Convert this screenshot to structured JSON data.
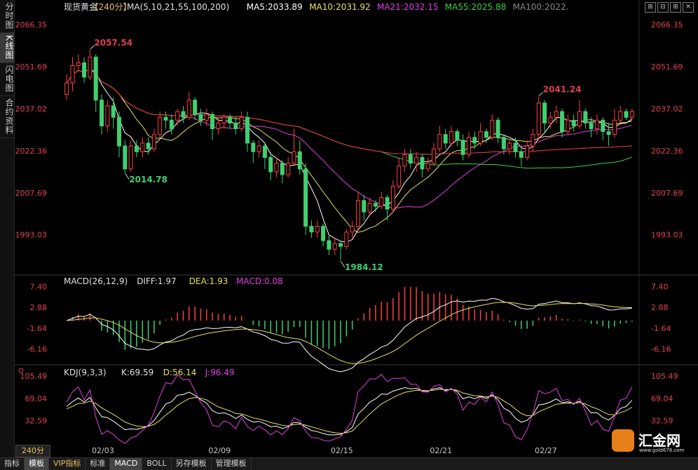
{
  "sidebar": {
    "tabs": [
      {
        "label": "分时图",
        "active": false
      },
      {
        "label": "K线图",
        "active": true
      },
      {
        "label": "闪电图",
        "active": false
      },
      {
        "label": "合约资料",
        "active": false
      }
    ]
  },
  "header": {
    "symbol": "现货黄金",
    "period": "【240分】",
    "ma_label": "MA(5,10,21,55,100,200)",
    "ma5": "MA5:2033.89",
    "ma10": "MA10:2031.92",
    "ma21": "MA21:2032.15",
    "ma55": "MA55:2025.88",
    "ma100": "MA100:2022."
  },
  "window_buttons": [
    "⊞",
    "⊟",
    "⊞",
    "✕"
  ],
  "macd_header": {
    "label": "MACD(26,12,9)",
    "diff": "DIFF:1.97",
    "dea": "DEA:1.93",
    "macd": "MACD:0.08"
  },
  "kdj_header": {
    "label": "KDJ(9,3,3)",
    "k": "K:69.59",
    "d": "D:56.14",
    "j": "J:96.49"
  },
  "price_axis": [
    "2066.35",
    "2051.69",
    "2037.02",
    "2022.36",
    "2007.69",
    "1993.03"
  ],
  "macd_axis": [
    "7.40",
    "2.88",
    "-1.64",
    "-6.16"
  ],
  "kdj_axis": [
    "105.49",
    "69.04",
    "32.59"
  ],
  "annotations": {
    "high": "2057.54",
    "low_left": "2014.78",
    "low": "1984.12",
    "high_right": "2041.24"
  },
  "date_labels": [
    "02/03",
    "02/09",
    "02/15",
    "02/21",
    "02/27"
  ],
  "period_label": "240分",
  "bottom_tabs": [
    {
      "label": "指标",
      "active": false,
      "vip": false
    },
    {
      "label": "模板",
      "active": true,
      "vip": false
    },
    {
      "label": "VIP指标",
      "active": false,
      "vip": true
    },
    {
      "label": "标准",
      "active": false,
      "vip": false
    },
    {
      "label": "MACD",
      "active": true,
      "vip": false
    },
    {
      "label": "BOLL",
      "active": false,
      "vip": false
    },
    {
      "label": "另存模板",
      "active": false,
      "vip": false
    },
    {
      "label": "管理模板",
      "active": false,
      "vip": false
    }
  ],
  "watermark": {
    "text": "汇金网",
    "url": "www.gold678.com"
  },
  "colors": {
    "up": "#ff4040",
    "down": "#40d070",
    "ma5": "#ffffff",
    "ma10": "#e8e060",
    "ma21": "#e040e0",
    "ma55": "#40d040",
    "ma100": "#808080",
    "ma200": "#e03030",
    "axis_text": "#e04050"
  },
  "chart_data": {
    "type": "candlestick",
    "price_range": [
      1980,
      2070
    ],
    "macd_range": [
      -9,
      9
    ],
    "kdj_range": [
      -5,
      115
    ],
    "dates": [
      "02/03",
      "02/09",
      "02/15",
      "02/21",
      "02/27"
    ],
    "candles": [
      [
        2042,
        2046,
        2040,
        2049,
        1
      ],
      [
        2046,
        2052,
        2043,
        2055,
        1
      ],
      [
        2052,
        2053,
        2050,
        2056,
        1
      ],
      [
        2053,
        2048,
        2046,
        2055,
        0
      ],
      [
        2048,
        2055,
        2047,
        2057.54,
        1
      ],
      [
        2055,
        2040,
        2036,
        2056,
        0
      ],
      [
        2040,
        2031,
        2028,
        2042,
        0
      ],
      [
        2031,
        2038,
        2029,
        2040,
        1
      ],
      [
        2038,
        2034,
        2030,
        2041,
        0
      ],
      [
        2034,
        2024,
        2020,
        2036,
        0
      ],
      [
        2024,
        2016,
        2014.78,
        2026,
        0
      ],
      [
        2016,
        2024,
        2015,
        2026,
        1
      ],
      [
        2024,
        2022,
        2020,
        2026,
        0
      ],
      [
        2022,
        2025,
        2020,
        2027,
        1
      ],
      [
        2025,
        2023,
        2021,
        2027,
        0
      ],
      [
        2023,
        2028,
        2022,
        2030,
        1
      ],
      [
        2028,
        2034,
        2027,
        2036,
        1
      ],
      [
        2034,
        2033,
        2030,
        2036,
        0
      ],
      [
        2033,
        2030,
        2028,
        2035,
        0
      ],
      [
        2033,
        2036,
        2031,
        2037,
        1
      ],
      [
        2036,
        2034,
        2032,
        2038,
        0
      ],
      [
        2034,
        2040,
        2033,
        2043,
        1
      ],
      [
        2040,
        2035,
        2033,
        2041,
        0
      ],
      [
        2035,
        2033,
        2031,
        2037,
        0
      ],
      [
        2033,
        2035,
        2031,
        2037,
        1
      ],
      [
        2035,
        2030,
        2026,
        2036,
        0
      ],
      [
        2030,
        2032,
        2028,
        2034,
        1
      ],
      [
        2032,
        2034,
        2030,
        2035,
        1
      ],
      [
        2034,
        2032,
        2030,
        2035,
        0
      ],
      [
        2032,
        2030,
        2028,
        2034,
        0
      ],
      [
        2030,
        2034,
        2029,
        2036,
        1
      ],
      [
        2034,
        2025,
        2022,
        2036,
        0
      ],
      [
        2025,
        2022,
        2018,
        2026,
        0
      ],
      [
        2022,
        2024,
        2020,
        2026,
        1
      ],
      [
        2024,
        2020,
        2016,
        2025,
        0
      ],
      [
        2020,
        2015,
        2012,
        2022,
        0
      ],
      [
        2015,
        2018,
        2013,
        2020,
        1
      ],
      [
        2018,
        2014,
        2011,
        2019,
        0
      ],
      [
        2014,
        2018,
        2013,
        2020,
        1
      ],
      [
        2018,
        2022,
        2017,
        2030,
        1
      ],
      [
        2022,
        2016,
        2014,
        2026,
        0
      ],
      [
        2016,
        1996,
        1993,
        2018,
        0
      ],
      [
        1996,
        1994,
        1992,
        1998,
        0
      ],
      [
        1994,
        1996,
        1992,
        1998,
        1
      ],
      [
        1996,
        1991,
        1989,
        1997,
        0
      ],
      [
        1991,
        1988,
        1986,
        1993,
        0
      ],
      [
        1988,
        1990,
        1986,
        1992,
        1
      ],
      [
        1990,
        1989,
        1984.12,
        1991,
        0
      ],
      [
        1989,
        1994,
        1988,
        1995,
        1
      ],
      [
        1994,
        1996,
        1992,
        1998,
        1
      ],
      [
        1996,
        2005,
        1995,
        2008,
        1
      ],
      [
        2005,
        2001,
        1998,
        2007,
        0
      ],
      [
        2001,
        2004,
        2000,
        2006,
        1
      ],
      [
        2004,
        2003,
        2001,
        2005,
        0
      ],
      [
        2003,
        2006,
        2002,
        2008,
        1
      ],
      [
        2006,
        2002,
        1998,
        2007,
        0
      ],
      [
        2002,
        2010,
        2001,
        2012,
        1
      ],
      [
        2010,
        2017,
        2009,
        2020,
        1
      ],
      [
        2017,
        2021,
        2015,
        2023,
        1
      ],
      [
        2021,
        2018,
        2016,
        2023,
        0
      ],
      [
        2018,
        2020,
        2015,
        2022,
        1
      ],
      [
        2020,
        2016,
        2013,
        2021,
        0
      ],
      [
        2016,
        2018,
        2015,
        2020,
        1
      ],
      [
        2018,
        2023,
        2017,
        2025,
        1
      ],
      [
        2023,
        2028,
        2022,
        2031,
        1
      ],
      [
        2028,
        2025,
        2023,
        2030,
        0
      ],
      [
        2025,
        2029,
        2024,
        2031,
        1
      ],
      [
        2029,
        2026,
        2024,
        2030,
        0
      ],
      [
        2026,
        2021,
        2019,
        2028,
        0
      ],
      [
        2021,
        2027,
        2020,
        2029,
        1
      ],
      [
        2027,
        2025,
        2023,
        2029,
        0
      ],
      [
        2025,
        2029,
        2024,
        2032,
        1
      ],
      [
        2029,
        2027,
        2025,
        2030,
        0
      ],
      [
        2027,
        2033,
        2026,
        2035,
        1
      ],
      [
        2033,
        2027,
        2025,
        2034,
        0
      ],
      [
        2027,
        2023,
        2021,
        2028,
        0
      ],
      [
        2023,
        2025,
        2021,
        2026,
        1
      ],
      [
        2025,
        2022,
        2020,
        2027,
        0
      ],
      [
        2022,
        2020,
        2017,
        2024,
        0
      ],
      [
        2020,
        2024,
        2019,
        2026,
        1
      ],
      [
        2024,
        2028,
        2022,
        2030,
        1
      ],
      [
        2028,
        2039,
        2026,
        2041.24,
        1
      ],
      [
        2039,
        2032,
        2029,
        2040,
        0
      ],
      [
        2032,
        2034,
        2030,
        2036,
        1
      ],
      [
        2034,
        2036,
        2032,
        2038,
        1
      ],
      [
        2036,
        2029,
        2027,
        2037,
        0
      ],
      [
        2029,
        2033,
        2028,
        2035,
        1
      ],
      [
        2033,
        2031,
        2029,
        2035,
        0
      ],
      [
        2031,
        2036,
        2030,
        2040,
        1
      ],
      [
        2036,
        2032,
        2030,
        2037,
        0
      ],
      [
        2032,
        2030,
        2027,
        2034,
        0
      ],
      [
        2030,
        2033,
        2028,
        2035,
        1
      ],
      [
        2033,
        2029,
        2026,
        2034,
        0
      ],
      [
        2029,
        2028,
        2024,
        2032,
        0
      ],
      [
        2028,
        2033,
        2027,
        2037,
        1
      ],
      [
        2033,
        2036,
        2032,
        2038,
        1
      ],
      [
        2036,
        2034,
        2033,
        2037,
        0
      ],
      [
        2034,
        2036,
        2033,
        2037,
        1
      ]
    ]
  }
}
